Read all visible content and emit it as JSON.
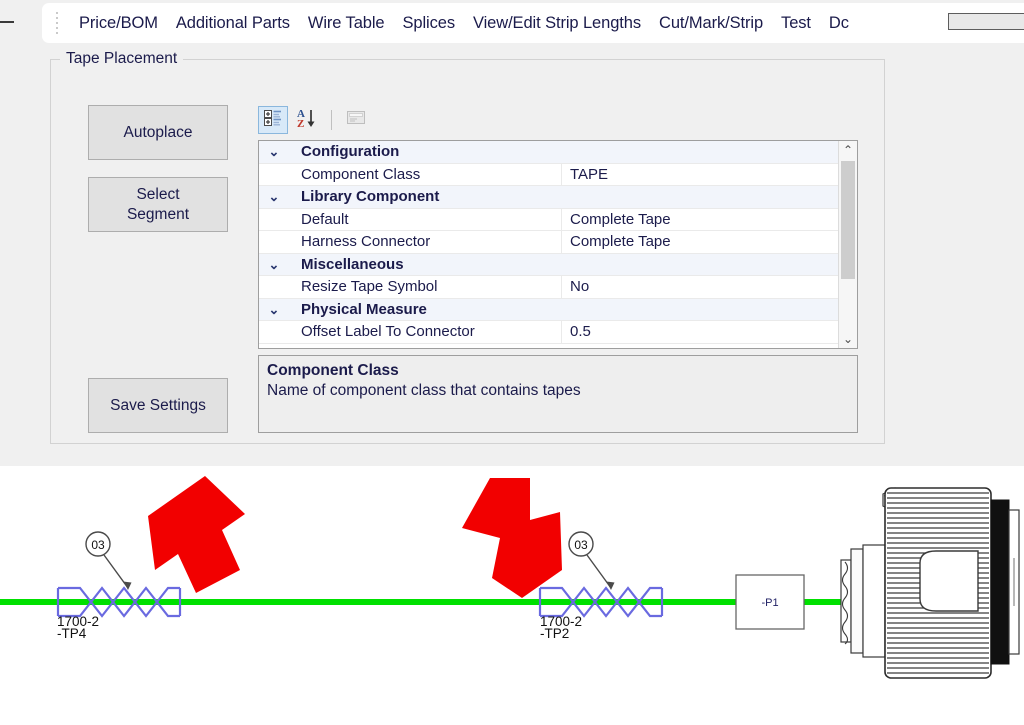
{
  "menubar": {
    "items": [
      {
        "label": "Price/BOM"
      },
      {
        "label": "Additional Parts"
      },
      {
        "label": "Wire Table"
      },
      {
        "label": "Splices"
      },
      {
        "label": "View/Edit Strip Lengths"
      },
      {
        "label": "Cut/Mark/Strip"
      },
      {
        "label": "Test"
      },
      {
        "label": "Dc"
      }
    ]
  },
  "groupbox": {
    "title": "Tape Placement"
  },
  "buttons": {
    "autoplace": "Autoplace",
    "select_segment_line1": "Select",
    "select_segment_line2": "Segment",
    "save_settings": "Save Settings"
  },
  "propgrid_toolbar": {
    "categorized_icon": "categorized-view-icon",
    "alphabetical_icon": "alphabetical-sort-icon",
    "property_pages_icon": "property-pages-icon"
  },
  "propgrid": {
    "expander_glyph": "⌄",
    "rows": [
      {
        "type": "category",
        "name": "Configuration",
        "value": ""
      },
      {
        "type": "prop",
        "name": "Component Class",
        "value": "TAPE"
      },
      {
        "type": "category",
        "name": "Library Component",
        "value": ""
      },
      {
        "type": "prop",
        "name": "Default",
        "value": "Complete Tape"
      },
      {
        "type": "prop",
        "name": "Harness Connector",
        "value": "Complete Tape"
      },
      {
        "type": "category",
        "name": "Miscellaneous",
        "value": ""
      },
      {
        "type": "prop",
        "name": "Resize Tape Symbol",
        "value": "No"
      },
      {
        "type": "category",
        "name": "Physical Measure",
        "value": ""
      },
      {
        "type": "prop",
        "name": "Offset Label To Connector",
        "value": "0.5"
      }
    ],
    "scrollbar": {
      "up_arrow": "⌃",
      "down_arrow": "⌄"
    }
  },
  "description": {
    "title": "Component Class",
    "text": "Name of component class that contains tapes"
  },
  "diagram": {
    "wire_color": "#00e000",
    "tape_color": "#6a6ae0",
    "arrow_color": "#f20000",
    "tapes": [
      {
        "balloon": "03",
        "label_line1": "1700-2",
        "label_line2": "-TP4"
      },
      {
        "balloon": "03",
        "label_line1": "1700-2",
        "label_line2": "-TP2"
      }
    ],
    "connector": {
      "label": "-P1"
    },
    "arrows": [
      {
        "name": "annotation-arrow-left"
      },
      {
        "name": "annotation-arrow-right"
      }
    ]
  },
  "colors": {
    "dialog_bg": "#f0f0f0",
    "button_bg": "#e1e1e1",
    "category_row_bg": "#f2f5fb",
    "text": "#1b1b4b",
    "wire_green": "#00e000",
    "tape_blue": "#6a6ae0",
    "arrow_red": "#f20000"
  }
}
